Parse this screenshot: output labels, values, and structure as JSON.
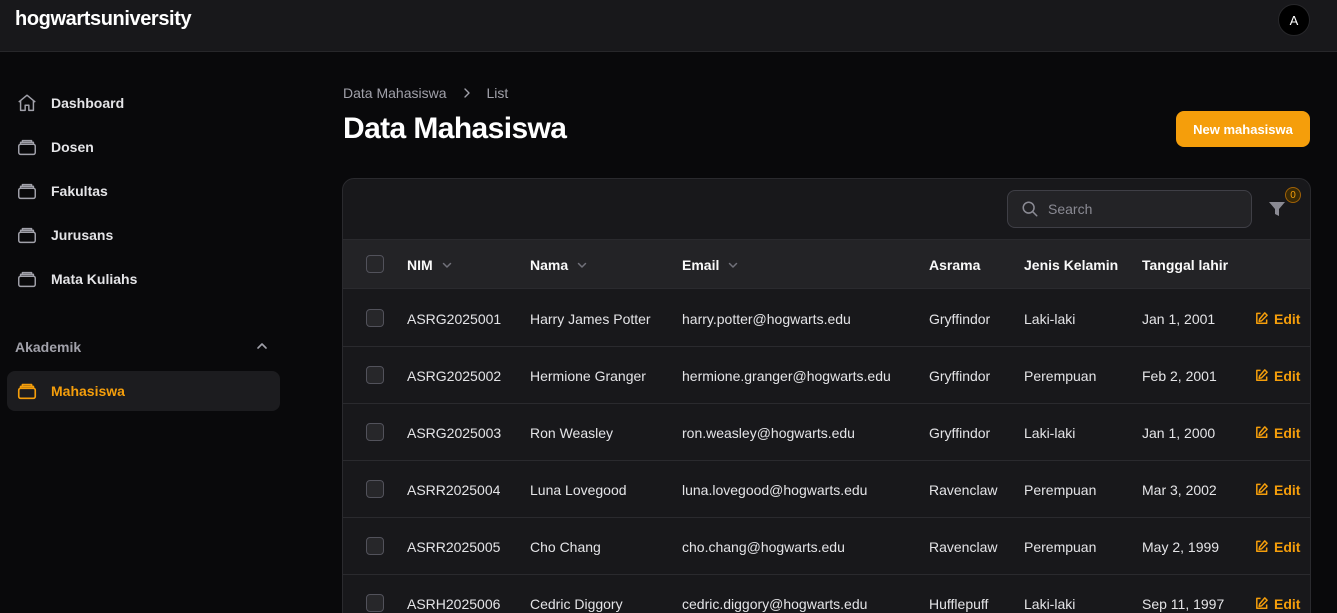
{
  "app": {
    "brand": "hogwartsuniversity",
    "avatar_initial": "A"
  },
  "sidebar": {
    "items": [
      {
        "label": "Dashboard",
        "icon": "home-icon"
      },
      {
        "label": "Dosen",
        "icon": "folder-icon"
      },
      {
        "label": "Fakultas",
        "icon": "folder-icon"
      },
      {
        "label": "Jurusans",
        "icon": "folder-icon"
      },
      {
        "label": "Mata Kuliahs",
        "icon": "folder-icon"
      }
    ],
    "group": {
      "label": "Akademik",
      "items": [
        {
          "label": "Mahasiswa",
          "icon": "folder-icon",
          "active": true
        }
      ]
    }
  },
  "breadcrumb": {
    "parent": "Data Mahasiswa",
    "current": "List"
  },
  "page": {
    "title": "Data Mahasiswa",
    "new_button": "New mahasiswa"
  },
  "table": {
    "search_placeholder": "Search",
    "filter_count": "0",
    "columns": {
      "nim": "NIM",
      "nama": "Nama",
      "email": "Email",
      "asrama": "Asrama",
      "jenis_kelamin": "Jenis Kelamin",
      "tanggal_lahir": "Tanggal lahir"
    },
    "edit_label": "Edit",
    "rows": [
      {
        "nim": "ASRG2025001",
        "nama": "Harry James Potter",
        "email": "harry.potter@hogwarts.edu",
        "asrama": "Gryffindor",
        "jenis_kelamin": "Laki-laki",
        "tanggal_lahir": "Jan 1, 2001"
      },
      {
        "nim": "ASRG2025002",
        "nama": "Hermione Granger",
        "email": "hermione.granger@hogwarts.edu",
        "asrama": "Gryffindor",
        "jenis_kelamin": "Perempuan",
        "tanggal_lahir": "Feb 2, 2001"
      },
      {
        "nim": "ASRG2025003",
        "nama": "Ron Weasley",
        "email": "ron.weasley@hogwarts.edu",
        "asrama": "Gryffindor",
        "jenis_kelamin": "Laki-laki",
        "tanggal_lahir": "Jan 1, 2000"
      },
      {
        "nim": "ASRR2025004",
        "nama": "Luna Lovegood",
        "email": "luna.lovegood@hogwarts.edu",
        "asrama": "Ravenclaw",
        "jenis_kelamin": "Perempuan",
        "tanggal_lahir": "Mar 3, 2002"
      },
      {
        "nim": "ASRR2025005",
        "nama": "Cho Chang",
        "email": "cho.chang@hogwarts.edu",
        "asrama": "Ravenclaw",
        "jenis_kelamin": "Perempuan",
        "tanggal_lahir": "May 2, 1999"
      },
      {
        "nim": "ASRH2025006",
        "nama": "Cedric Diggory",
        "email": "cedric.diggory@hogwarts.edu",
        "asrama": "Hufflepuff",
        "jenis_kelamin": "Laki-laki",
        "tanggal_lahir": "Sep 11, 1997"
      }
    ]
  },
  "colors": {
    "accent": "#f59e0b",
    "background": "#09090b",
    "surface": "#18181b"
  }
}
